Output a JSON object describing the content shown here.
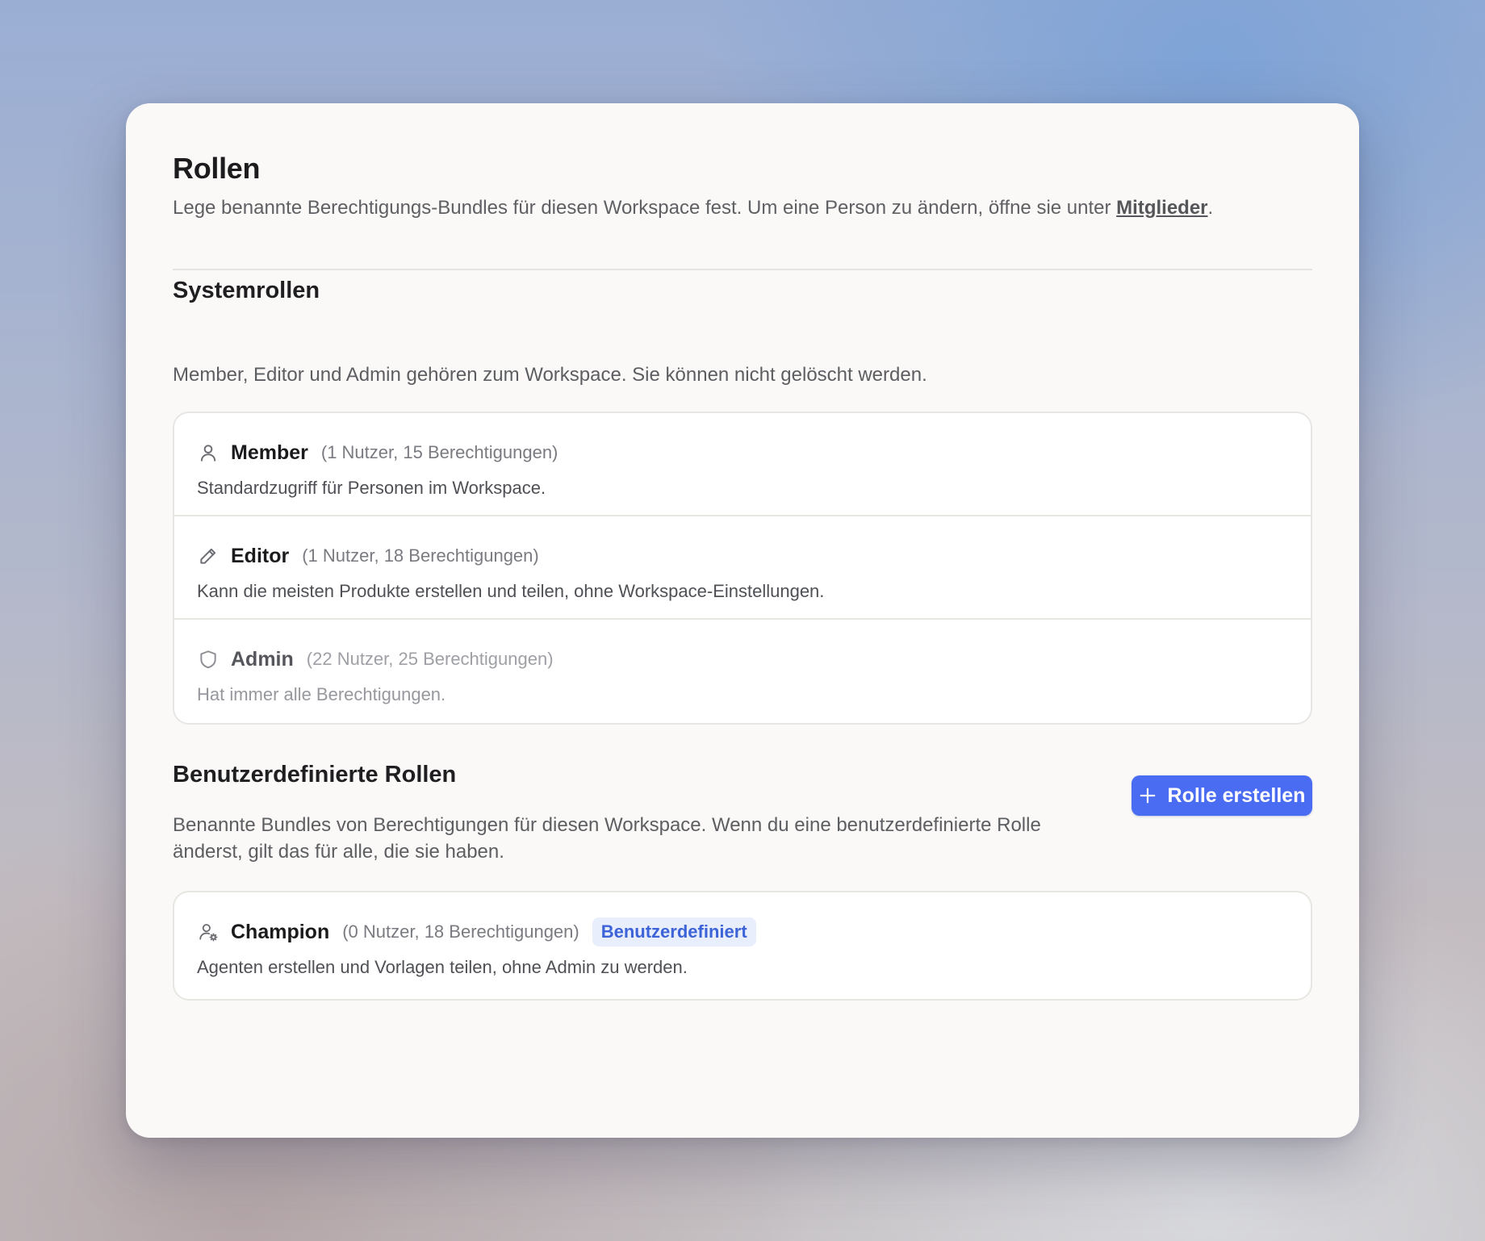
{
  "header": {
    "title": "Rollen",
    "subtitle": "Lege benannte Berechtigungs-Bundles für diesen Workspace fest. Um eine Person zu ändern, öffne sie unter ",
    "subtitle_link": "Mitglieder",
    "subtitle_end": "."
  },
  "system_roles": {
    "title": "Systemrollen",
    "description": "Member, Editor und Admin gehören zum Workspace. Sie können nicht gelöscht werden.",
    "items": [
      {
        "icon": "user-icon",
        "name": "Member",
        "meta": "(1 Nutzer, 15 Berechtigungen)",
        "description": "Standardzugriff für Personen im Workspace."
      },
      {
        "icon": "pencil-icon",
        "name": "Editor",
        "meta": "(1 Nutzer, 18 Berechtigungen)",
        "description": "Kann die meisten Produkte erstellen und teilen, ohne Workspace-Einstellungen."
      },
      {
        "icon": "shield-icon",
        "name": "Admin",
        "meta": "(22 Nutzer, 25 Berechtigungen)",
        "description": "Hat immer alle Berechtigungen."
      }
    ]
  },
  "custom_roles": {
    "title": "Benutzerdefinierte Rollen",
    "description_line1": "Benannte Bundles von Berechtigungen für diesen Workspace. Wenn du eine benutzerdefinierte Rolle",
    "description_line2": "änderst, gilt das für alle, die sie haben.",
    "create_button": "Rolle erstellen",
    "items": [
      {
        "icon": "user-gear-icon",
        "name": "Champion",
        "meta": "(0 Nutzer, 18 Berechtigungen)",
        "badge": "Benutzerdefiniert",
        "description": "Agenten erstellen und Vorlagen teilen, ohne Admin zu werden."
      }
    ]
  },
  "colors": {
    "accent": "#4a6cf2",
    "badge_bg": "#e8eefc",
    "badge_text": "#3d63d8"
  }
}
